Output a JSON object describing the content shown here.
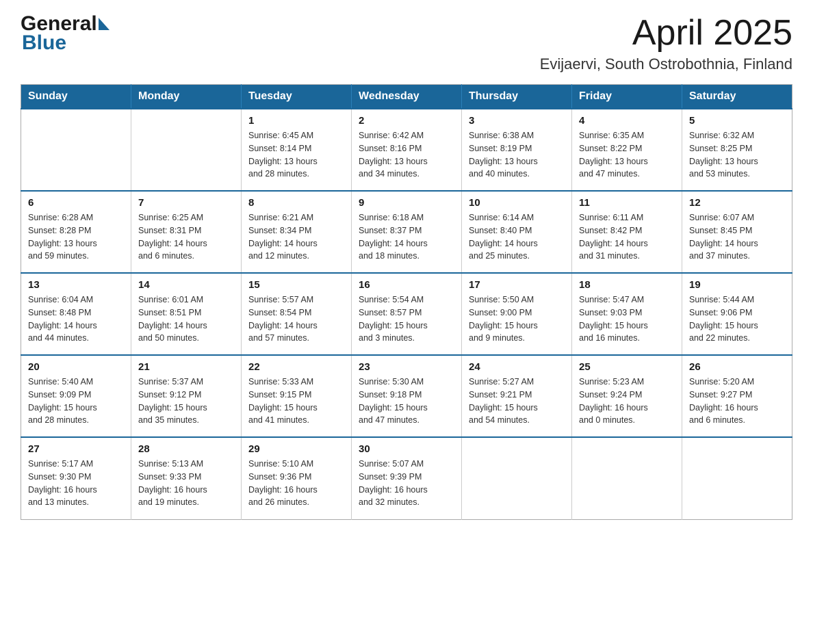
{
  "header": {
    "logo": {
      "general": "General",
      "blue": "Blue"
    },
    "title": "April 2025",
    "location": "Evijaervi, South Ostrobothnia, Finland"
  },
  "calendar": {
    "days_of_week": [
      "Sunday",
      "Monday",
      "Tuesday",
      "Wednesday",
      "Thursday",
      "Friday",
      "Saturday"
    ],
    "weeks": [
      [
        {
          "day": "",
          "info": ""
        },
        {
          "day": "",
          "info": ""
        },
        {
          "day": "1",
          "info": "Sunrise: 6:45 AM\nSunset: 8:14 PM\nDaylight: 13 hours\nand 28 minutes."
        },
        {
          "day": "2",
          "info": "Sunrise: 6:42 AM\nSunset: 8:16 PM\nDaylight: 13 hours\nand 34 minutes."
        },
        {
          "day": "3",
          "info": "Sunrise: 6:38 AM\nSunset: 8:19 PM\nDaylight: 13 hours\nand 40 minutes."
        },
        {
          "day": "4",
          "info": "Sunrise: 6:35 AM\nSunset: 8:22 PM\nDaylight: 13 hours\nand 47 minutes."
        },
        {
          "day": "5",
          "info": "Sunrise: 6:32 AM\nSunset: 8:25 PM\nDaylight: 13 hours\nand 53 minutes."
        }
      ],
      [
        {
          "day": "6",
          "info": "Sunrise: 6:28 AM\nSunset: 8:28 PM\nDaylight: 13 hours\nand 59 minutes."
        },
        {
          "day": "7",
          "info": "Sunrise: 6:25 AM\nSunset: 8:31 PM\nDaylight: 14 hours\nand 6 minutes."
        },
        {
          "day": "8",
          "info": "Sunrise: 6:21 AM\nSunset: 8:34 PM\nDaylight: 14 hours\nand 12 minutes."
        },
        {
          "day": "9",
          "info": "Sunrise: 6:18 AM\nSunset: 8:37 PM\nDaylight: 14 hours\nand 18 minutes."
        },
        {
          "day": "10",
          "info": "Sunrise: 6:14 AM\nSunset: 8:40 PM\nDaylight: 14 hours\nand 25 minutes."
        },
        {
          "day": "11",
          "info": "Sunrise: 6:11 AM\nSunset: 8:42 PM\nDaylight: 14 hours\nand 31 minutes."
        },
        {
          "day": "12",
          "info": "Sunrise: 6:07 AM\nSunset: 8:45 PM\nDaylight: 14 hours\nand 37 minutes."
        }
      ],
      [
        {
          "day": "13",
          "info": "Sunrise: 6:04 AM\nSunset: 8:48 PM\nDaylight: 14 hours\nand 44 minutes."
        },
        {
          "day": "14",
          "info": "Sunrise: 6:01 AM\nSunset: 8:51 PM\nDaylight: 14 hours\nand 50 minutes."
        },
        {
          "day": "15",
          "info": "Sunrise: 5:57 AM\nSunset: 8:54 PM\nDaylight: 14 hours\nand 57 minutes."
        },
        {
          "day": "16",
          "info": "Sunrise: 5:54 AM\nSunset: 8:57 PM\nDaylight: 15 hours\nand 3 minutes."
        },
        {
          "day": "17",
          "info": "Sunrise: 5:50 AM\nSunset: 9:00 PM\nDaylight: 15 hours\nand 9 minutes."
        },
        {
          "day": "18",
          "info": "Sunrise: 5:47 AM\nSunset: 9:03 PM\nDaylight: 15 hours\nand 16 minutes."
        },
        {
          "day": "19",
          "info": "Sunrise: 5:44 AM\nSunset: 9:06 PM\nDaylight: 15 hours\nand 22 minutes."
        }
      ],
      [
        {
          "day": "20",
          "info": "Sunrise: 5:40 AM\nSunset: 9:09 PM\nDaylight: 15 hours\nand 28 minutes."
        },
        {
          "day": "21",
          "info": "Sunrise: 5:37 AM\nSunset: 9:12 PM\nDaylight: 15 hours\nand 35 minutes."
        },
        {
          "day": "22",
          "info": "Sunrise: 5:33 AM\nSunset: 9:15 PM\nDaylight: 15 hours\nand 41 minutes."
        },
        {
          "day": "23",
          "info": "Sunrise: 5:30 AM\nSunset: 9:18 PM\nDaylight: 15 hours\nand 47 minutes."
        },
        {
          "day": "24",
          "info": "Sunrise: 5:27 AM\nSunset: 9:21 PM\nDaylight: 15 hours\nand 54 minutes."
        },
        {
          "day": "25",
          "info": "Sunrise: 5:23 AM\nSunset: 9:24 PM\nDaylight: 16 hours\nand 0 minutes."
        },
        {
          "day": "26",
          "info": "Sunrise: 5:20 AM\nSunset: 9:27 PM\nDaylight: 16 hours\nand 6 minutes."
        }
      ],
      [
        {
          "day": "27",
          "info": "Sunrise: 5:17 AM\nSunset: 9:30 PM\nDaylight: 16 hours\nand 13 minutes."
        },
        {
          "day": "28",
          "info": "Sunrise: 5:13 AM\nSunset: 9:33 PM\nDaylight: 16 hours\nand 19 minutes."
        },
        {
          "day": "29",
          "info": "Sunrise: 5:10 AM\nSunset: 9:36 PM\nDaylight: 16 hours\nand 26 minutes."
        },
        {
          "day": "30",
          "info": "Sunrise: 5:07 AM\nSunset: 9:39 PM\nDaylight: 16 hours\nand 32 minutes."
        },
        {
          "day": "",
          "info": ""
        },
        {
          "day": "",
          "info": ""
        },
        {
          "day": "",
          "info": ""
        }
      ]
    ]
  }
}
